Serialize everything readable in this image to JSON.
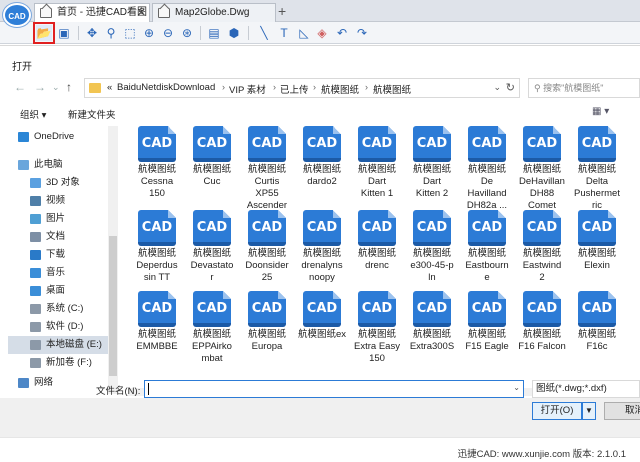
{
  "app": {
    "logo_text": "CAD"
  },
  "tabs": [
    {
      "label": "首页 - 迅捷CAD看图",
      "active": true
    },
    {
      "label": "Map2Globe.Dwg",
      "active": false
    }
  ],
  "tab_close_glyph": "✕",
  "tab_add_glyph": "+",
  "toolbar": {
    "icons": [
      "open-file-icon",
      "save-icon",
      "pan-icon",
      "zoom-realtime-icon",
      "zoom-window-icon",
      "zoom-in-icon",
      "zoom-out-icon",
      "zoom-extents-icon",
      "layers-icon",
      "3d-view-icon",
      "line-icon",
      "text-icon",
      "measure-icon",
      "eraser-icon",
      "undo-icon",
      "redo-icon"
    ]
  },
  "dialog": {
    "title": "打开",
    "path": [
      "BaiduNetdiskDownload",
      "VIP 素材",
      "已上传",
      "航模图纸",
      "航模图纸"
    ],
    "path_prefix": "«",
    "search_placeholder": "搜索\"航模图纸\"",
    "commands": {
      "organize": "组织 ▾",
      "new_folder": "新建文件夹"
    },
    "sidebar": [
      {
        "label": "OneDrive",
        "icon": "onedrive-icon",
        "color": "#2b86d6"
      },
      {
        "label": "此电脑",
        "icon": "computer-icon",
        "color": "#6aa6dc"
      },
      {
        "label": "3D 对象",
        "icon": "3d-objects-icon",
        "color": "#5aa0e0"
      },
      {
        "label": "视频",
        "icon": "video-icon",
        "color": "#4f7fa8"
      },
      {
        "label": "图片",
        "icon": "pictures-icon",
        "color": "#4f9fd4"
      },
      {
        "label": "文档",
        "icon": "documents-icon",
        "color": "#7d8fa5"
      },
      {
        "label": "下载",
        "icon": "download-icon",
        "color": "#2a7ac8"
      },
      {
        "label": "音乐",
        "icon": "music-icon",
        "color": "#3b8ed8"
      },
      {
        "label": "桌面",
        "icon": "desktop-icon",
        "color": "#3b8ed8"
      },
      {
        "label": "系统 (C:)",
        "icon": "drive-icon",
        "color": "#8c99a8"
      },
      {
        "label": "软件 (D:)",
        "icon": "drive-icon",
        "color": "#8c99a8"
      },
      {
        "label": "本地磁盘 (E:)",
        "icon": "drive-icon",
        "color": "#8c99a8",
        "selected": true
      },
      {
        "label": "新加卷 (F:)",
        "icon": "drive-icon",
        "color": "#8c99a8"
      },
      {
        "label": "网络",
        "icon": "network-icon",
        "color": "#4d87c7"
      }
    ],
    "files": [
      {
        "icon_text": "CAD",
        "lines": [
          "航模图纸",
          "Cessna",
          "150"
        ]
      },
      {
        "icon_text": "CAD",
        "lines": [
          "航模图纸",
          "Cuc"
        ]
      },
      {
        "icon_text": "CAD",
        "lines": [
          "航模图纸",
          "Curtis",
          "XP55",
          "Ascender"
        ]
      },
      {
        "icon_text": "CAD",
        "lines": [
          "航模图纸",
          "dardo2"
        ]
      },
      {
        "icon_text": "CAD",
        "lines": [
          "航模图纸",
          "Dart",
          "Kitten 1"
        ]
      },
      {
        "icon_text": "CAD",
        "lines": [
          "航模图纸",
          "Dart",
          "Kitten 2"
        ]
      },
      {
        "icon_text": "CAD",
        "lines": [
          "航模图纸",
          "De",
          "Havilland",
          "DH82a ..."
        ]
      },
      {
        "icon_text": "CAD",
        "lines": [
          "航模图纸",
          "DeHavillan",
          "DH88",
          "Comet"
        ]
      },
      {
        "icon_text": "CAD",
        "lines": [
          "航模图纸",
          "Delta",
          "Pushermet",
          "ric"
        ]
      },
      {
        "icon_text": "CAD",
        "lines": [
          "航模图纸",
          "Deperdus",
          "sin TT"
        ]
      },
      {
        "icon_text": "CAD",
        "lines": [
          "航模图纸",
          "Devastato",
          "r"
        ]
      },
      {
        "icon_text": "CAD",
        "lines": [
          "航模图纸",
          "Doonsider",
          "25"
        ]
      },
      {
        "icon_text": "CAD",
        "lines": [
          "航模图纸",
          "drenalyns",
          "noopy"
        ]
      },
      {
        "icon_text": "CAD",
        "lines": [
          "航模图纸",
          "drenc"
        ]
      },
      {
        "icon_text": "CAD",
        "lines": [
          "航模图纸",
          "e300-45-p",
          "ln"
        ]
      },
      {
        "icon_text": "CAD",
        "lines": [
          "航模图纸",
          "Eastbourn",
          "e"
        ]
      },
      {
        "icon_text": "CAD",
        "lines": [
          "航模图纸",
          "Eastwind",
          "2"
        ]
      },
      {
        "icon_text": "CAD",
        "lines": [
          "航模图纸",
          "Elexin"
        ]
      },
      {
        "icon_text": "CAD",
        "lines": [
          "航模图纸",
          "EMMBBE"
        ]
      },
      {
        "icon_text": "CAD",
        "lines": [
          "航模图纸",
          "EPPAirko",
          "mbat"
        ]
      },
      {
        "icon_text": "CAD",
        "lines": [
          "航模图纸",
          "Europa"
        ]
      },
      {
        "icon_text": "CAD",
        "lines": [
          "航模图纸ex"
        ]
      },
      {
        "icon_text": "CAD",
        "lines": [
          "航模图纸",
          "Extra Easy",
          "150"
        ]
      },
      {
        "icon_text": "CAD",
        "lines": [
          "航模图纸",
          "Extra300S"
        ]
      },
      {
        "icon_text": "CAD",
        "lines": [
          "航模图纸",
          "F15 Eagle"
        ]
      },
      {
        "icon_text": "CAD",
        "lines": [
          "航模图纸",
          "F16 Falcon"
        ]
      },
      {
        "icon_text": "CAD",
        "lines": [
          "航模图纸",
          "F16c"
        ]
      }
    ],
    "file_name_label": "文件名(N):",
    "file_name_value": "",
    "filter": "图纸(*.dwg;*.dxf)",
    "open_button": "打开(O)",
    "cancel_button": "取消"
  },
  "status": "迅捷CAD: www.xunjie.com 版本: 2.1.0.1"
}
